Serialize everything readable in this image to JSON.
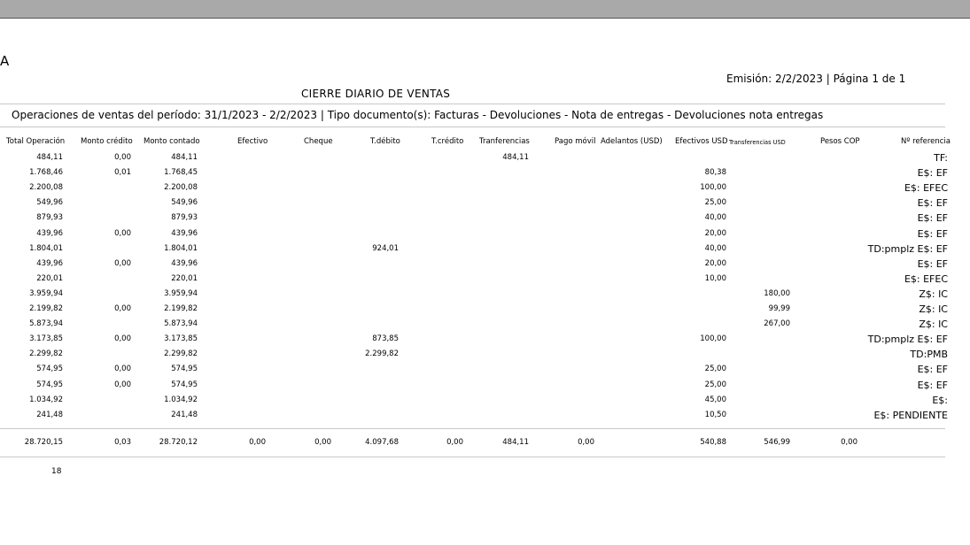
{
  "header": {
    "letter": "A",
    "emision": "Emisión: 2/2/2023 | Página 1 de 1",
    "title": "CIERRE DIARIO DE VENTAS",
    "operations": "Operaciones de ventas del período: 31/1/2023 - 2/2/2023 | Tipo documento(s): Facturas - Devoluciones - Nota de entregas - Devoluciones nota entregas"
  },
  "columns": [
    "Total Operación",
    "Monto crédito",
    "Monto contado",
    "Efectivo",
    "Cheque",
    "T.débito",
    "T.crédito",
    "Tranferencias",
    "Pago móvil",
    "Adelantos (USD)",
    "Efectivos USD",
    "Transferencias USD",
    "Pesos COP",
    "Nº referencia"
  ],
  "rows": [
    {
      "total": "484,11",
      "credito": "0,00",
      "contado": "484,11",
      "efectivo": "",
      "cheque": "",
      "tdebito": "",
      "tcredito": "",
      "transf": "484,11",
      "pmovil": "",
      "adelantos": "",
      "efusd": "",
      "trusd": "",
      "cop": "",
      "ref": "TF:"
    },
    {
      "total": "1.768,46",
      "credito": "0,01",
      "contado": "1.768,45",
      "efectivo": "",
      "cheque": "",
      "tdebito": "",
      "tcredito": "",
      "transf": "",
      "pmovil": "",
      "adelantos": "",
      "efusd": "80,38",
      "trusd": "",
      "cop": "",
      "ref": "E$: EF"
    },
    {
      "total": "2.200,08",
      "credito": "",
      "contado": "2.200,08",
      "efectivo": "",
      "cheque": "",
      "tdebito": "",
      "tcredito": "",
      "transf": "",
      "pmovil": "",
      "adelantos": "",
      "efusd": "100,00",
      "trusd": "",
      "cop": "",
      "ref": "E$: EFEC"
    },
    {
      "total": "549,96",
      "credito": "",
      "contado": "549,96",
      "efectivo": "",
      "cheque": "",
      "tdebito": "",
      "tcredito": "",
      "transf": "",
      "pmovil": "",
      "adelantos": "",
      "efusd": "25,00",
      "trusd": "",
      "cop": "",
      "ref": "E$: EF"
    },
    {
      "total": "879,93",
      "credito": "",
      "contado": "879,93",
      "efectivo": "",
      "cheque": "",
      "tdebito": "",
      "tcredito": "",
      "transf": "",
      "pmovil": "",
      "adelantos": "",
      "efusd": "40,00",
      "trusd": "",
      "cop": "",
      "ref": "E$: EF"
    },
    {
      "total": "439,96",
      "credito": "0,00",
      "contado": "439,96",
      "efectivo": "",
      "cheque": "",
      "tdebito": "",
      "tcredito": "",
      "transf": "",
      "pmovil": "",
      "adelantos": "",
      "efusd": "20,00",
      "trusd": "",
      "cop": "",
      "ref": "E$: EF"
    },
    {
      "total": "1.804,01",
      "credito": "",
      "contado": "1.804,01",
      "efectivo": "",
      "cheque": "",
      "tdebito": "924,01",
      "tcredito": "",
      "transf": "",
      "pmovil": "",
      "adelantos": "",
      "efusd": "40,00",
      "trusd": "",
      "cop": "",
      "ref": "TD:pmplz E$: EF"
    },
    {
      "total": "439,96",
      "credito": "0,00",
      "contado": "439,96",
      "efectivo": "",
      "cheque": "",
      "tdebito": "",
      "tcredito": "",
      "transf": "",
      "pmovil": "",
      "adelantos": "",
      "efusd": "20,00",
      "trusd": "",
      "cop": "",
      "ref": "E$: EF"
    },
    {
      "total": "220,01",
      "credito": "",
      "contado": "220,01",
      "efectivo": "",
      "cheque": "",
      "tdebito": "",
      "tcredito": "",
      "transf": "",
      "pmovil": "",
      "adelantos": "",
      "efusd": "10,00",
      "trusd": "",
      "cop": "",
      "ref": "E$: EFEC"
    },
    {
      "total": "3.959,94",
      "credito": "",
      "contado": "3.959,94",
      "efectivo": "",
      "cheque": "",
      "tdebito": "",
      "tcredito": "",
      "transf": "",
      "pmovil": "",
      "adelantos": "",
      "efusd": "",
      "trusd": "180,00",
      "cop": "",
      "ref": "Z$: IC"
    },
    {
      "total": "2.199,82",
      "credito": "0,00",
      "contado": "2.199,82",
      "efectivo": "",
      "cheque": "",
      "tdebito": "",
      "tcredito": "",
      "transf": "",
      "pmovil": "",
      "adelantos": "",
      "efusd": "",
      "trusd": "99,99",
      "cop": "",
      "ref": "Z$: IC"
    },
    {
      "total": "5.873,94",
      "credito": "",
      "contado": "5.873,94",
      "efectivo": "",
      "cheque": "",
      "tdebito": "",
      "tcredito": "",
      "transf": "",
      "pmovil": "",
      "adelantos": "",
      "efusd": "",
      "trusd": "267,00",
      "cop": "",
      "ref": "Z$: IC"
    },
    {
      "total": "3.173,85",
      "credito": "0,00",
      "contado": "3.173,85",
      "efectivo": "",
      "cheque": "",
      "tdebito": "873,85",
      "tcredito": "",
      "transf": "",
      "pmovil": "",
      "adelantos": "",
      "efusd": "100,00",
      "trusd": "",
      "cop": "",
      "ref": "TD:pmplz E$: EF"
    },
    {
      "total": "2.299,82",
      "credito": "",
      "contado": "2.299,82",
      "efectivo": "",
      "cheque": "",
      "tdebito": "2.299,82",
      "tcredito": "",
      "transf": "",
      "pmovil": "",
      "adelantos": "",
      "efusd": "",
      "trusd": "",
      "cop": "",
      "ref": "TD:PMB"
    },
    {
      "total": "574,95",
      "credito": "0,00",
      "contado": "574,95",
      "efectivo": "",
      "cheque": "",
      "tdebito": "",
      "tcredito": "",
      "transf": "",
      "pmovil": "",
      "adelantos": "",
      "efusd": "25,00",
      "trusd": "",
      "cop": "",
      "ref": "E$: EF"
    },
    {
      "total": "574,95",
      "credito": "0,00",
      "contado": "574,95",
      "efectivo": "",
      "cheque": "",
      "tdebito": "",
      "tcredito": "",
      "transf": "",
      "pmovil": "",
      "adelantos": "",
      "efusd": "25,00",
      "trusd": "",
      "cop": "",
      "ref": "E$: EF"
    },
    {
      "total": "1.034,92",
      "credito": "",
      "contado": "1.034,92",
      "efectivo": "",
      "cheque": "",
      "tdebito": "",
      "tcredito": "",
      "transf": "",
      "pmovil": "",
      "adelantos": "",
      "efusd": "45,00",
      "trusd": "",
      "cop": "",
      "ref": "E$:"
    },
    {
      "total": "241,48",
      "credito": "",
      "contado": "241,48",
      "efectivo": "",
      "cheque": "",
      "tdebito": "",
      "tcredito": "",
      "transf": "",
      "pmovil": "",
      "adelantos": "",
      "efusd": "10,50",
      "trusd": "",
      "cop": "",
      "ref": "E$: PENDIENTE"
    }
  ],
  "totals": {
    "total": "28.720,15",
    "credito": "0,03",
    "contado": "28.720,12",
    "efectivo": "0,00",
    "cheque": "0,00",
    "tdebito": "4.097,68",
    "tcredito": "0,00",
    "transf": "484,11",
    "pmovil": "0,00",
    "adelantos": "",
    "efusd": "540,88",
    "trusd": "546,99",
    "cop": "0,00"
  },
  "count": "18"
}
